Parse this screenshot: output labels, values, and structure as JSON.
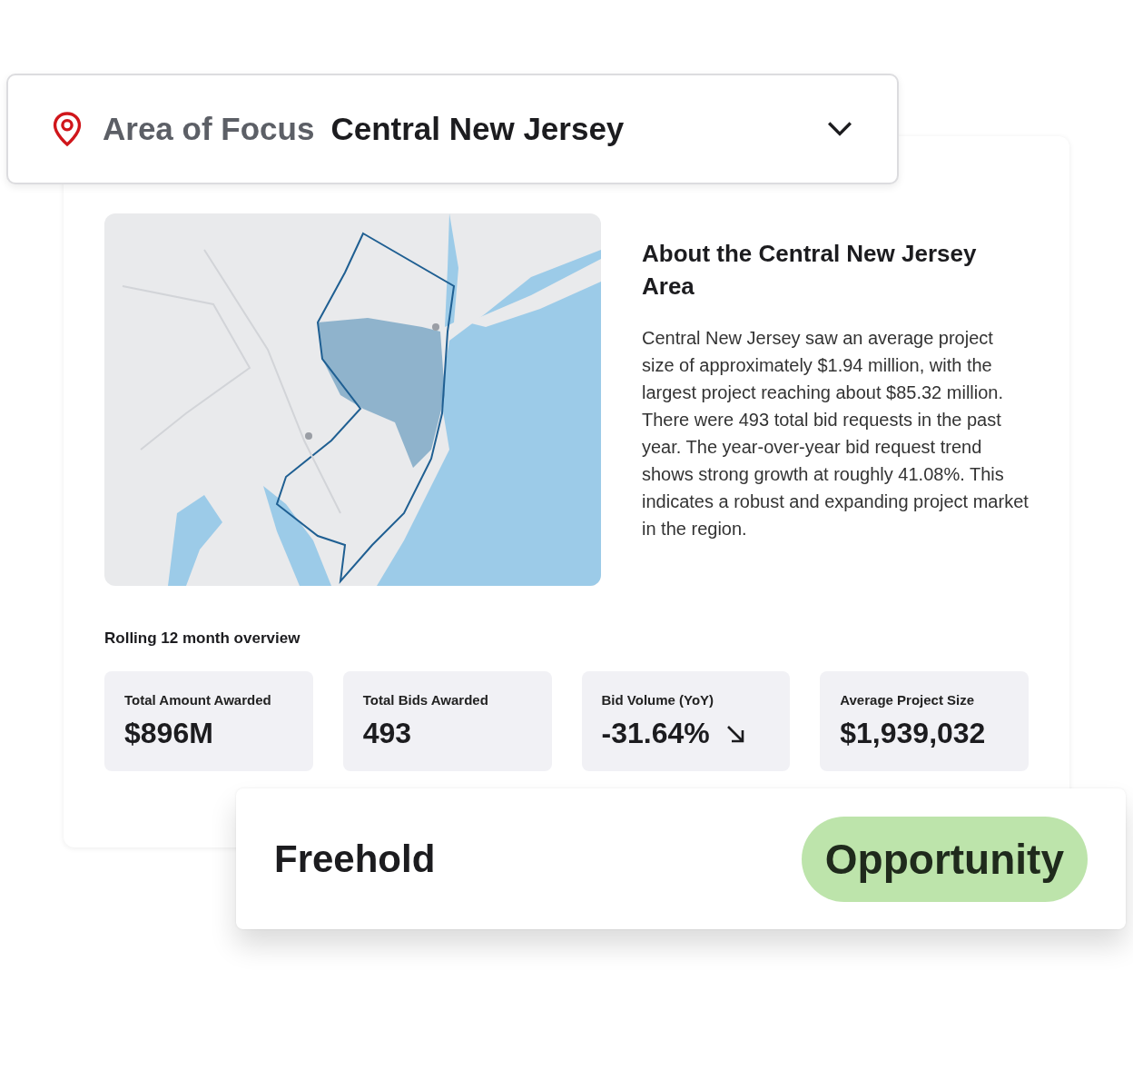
{
  "area_selector": {
    "label": "Area of Focus",
    "value": "Central New Jersey"
  },
  "about": {
    "title": "About the Central New Jersey Area",
    "body": "Central New Jersey saw an average project size of approximately $1.94 million, with the largest project reaching about $85.32 million. There were 493 total bid requests in the past year. The year-over-year bid request trend shows strong growth at roughly 41.08%. This indicates a robust and expanding project market in the region."
  },
  "overview": {
    "title": "Rolling 12 month overview",
    "stats": [
      {
        "kind": "plain",
        "label": "Total Amount Awarded",
        "value": "$896M"
      },
      {
        "kind": "plain",
        "label": "Total Bids Awarded",
        "value": "493"
      },
      {
        "kind": "falling",
        "label": "Bid Volume (YoY)",
        "value": "-31.64%"
      },
      {
        "kind": "plain",
        "label": "Average Project Size",
        "value": "$1,939,032"
      }
    ]
  },
  "listing": {
    "name": "Freehold",
    "badge": "Opportunity"
  }
}
